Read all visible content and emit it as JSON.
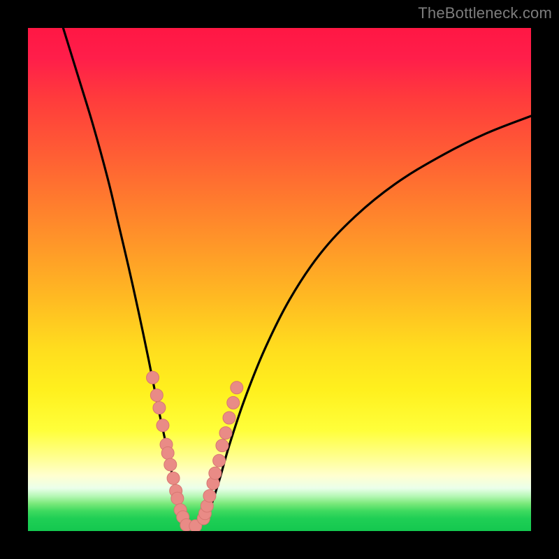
{
  "watermark": "TheBottleneck.com",
  "colors": {
    "frame": "#000000",
    "curve": "#000000",
    "dot_fill": "#e98b86",
    "dot_stroke": "#d77771",
    "gradient_top": "#ff1744",
    "gradient_bottom": "#14c84f"
  },
  "chart_data": {
    "type": "line",
    "title": "",
    "xlabel": "",
    "ylabel": "",
    "xlim": [
      0,
      100
    ],
    "ylim": [
      0,
      100
    ],
    "grid": false,
    "legend": false,
    "series": [
      {
        "name": "curve-left",
        "x": [
          7,
          10,
          13,
          16,
          18,
          20,
          22,
          24,
          26,
          27.5,
          28.5,
          29.5,
          30.5,
          31.5,
          32.5
        ],
        "values": [
          100,
          90.3,
          80.5,
          69.5,
          61,
          52.5,
          43.5,
          34,
          24,
          17,
          12,
          8,
          5,
          2.5,
          1
        ]
      },
      {
        "name": "curve-right",
        "x": [
          33,
          34.5,
          36,
          38,
          40,
          43,
          47,
          52,
          58,
          65,
          73,
          82,
          91,
          100
        ],
        "values": [
          0.5,
          1.5,
          4,
          10,
          17,
          26,
          36,
          46,
          55,
          62.5,
          69,
          74.5,
          79,
          82.5
        ]
      },
      {
        "name": "dots",
        "x": [
          24.8,
          25.6,
          26.1,
          26.8,
          27.5,
          27.8,
          28.3,
          28.9,
          29.4,
          29.7,
          30.3,
          30.8,
          31.5,
          33.3,
          34.9,
          35.2,
          35.6,
          36.1,
          36.8,
          37.2,
          38.0,
          38.6,
          39.3,
          40.0,
          40.8,
          41.5
        ],
        "values": [
          30.5,
          27.0,
          24.5,
          21.0,
          17.2,
          15.5,
          13.2,
          10.5,
          8.0,
          6.5,
          4.2,
          2.8,
          1.2,
          1.0,
          2.5,
          3.5,
          5.0,
          7.0,
          9.5,
          11.5,
          14.0,
          17.0,
          19.5,
          22.5,
          25.5,
          28.5
        ]
      }
    ]
  }
}
